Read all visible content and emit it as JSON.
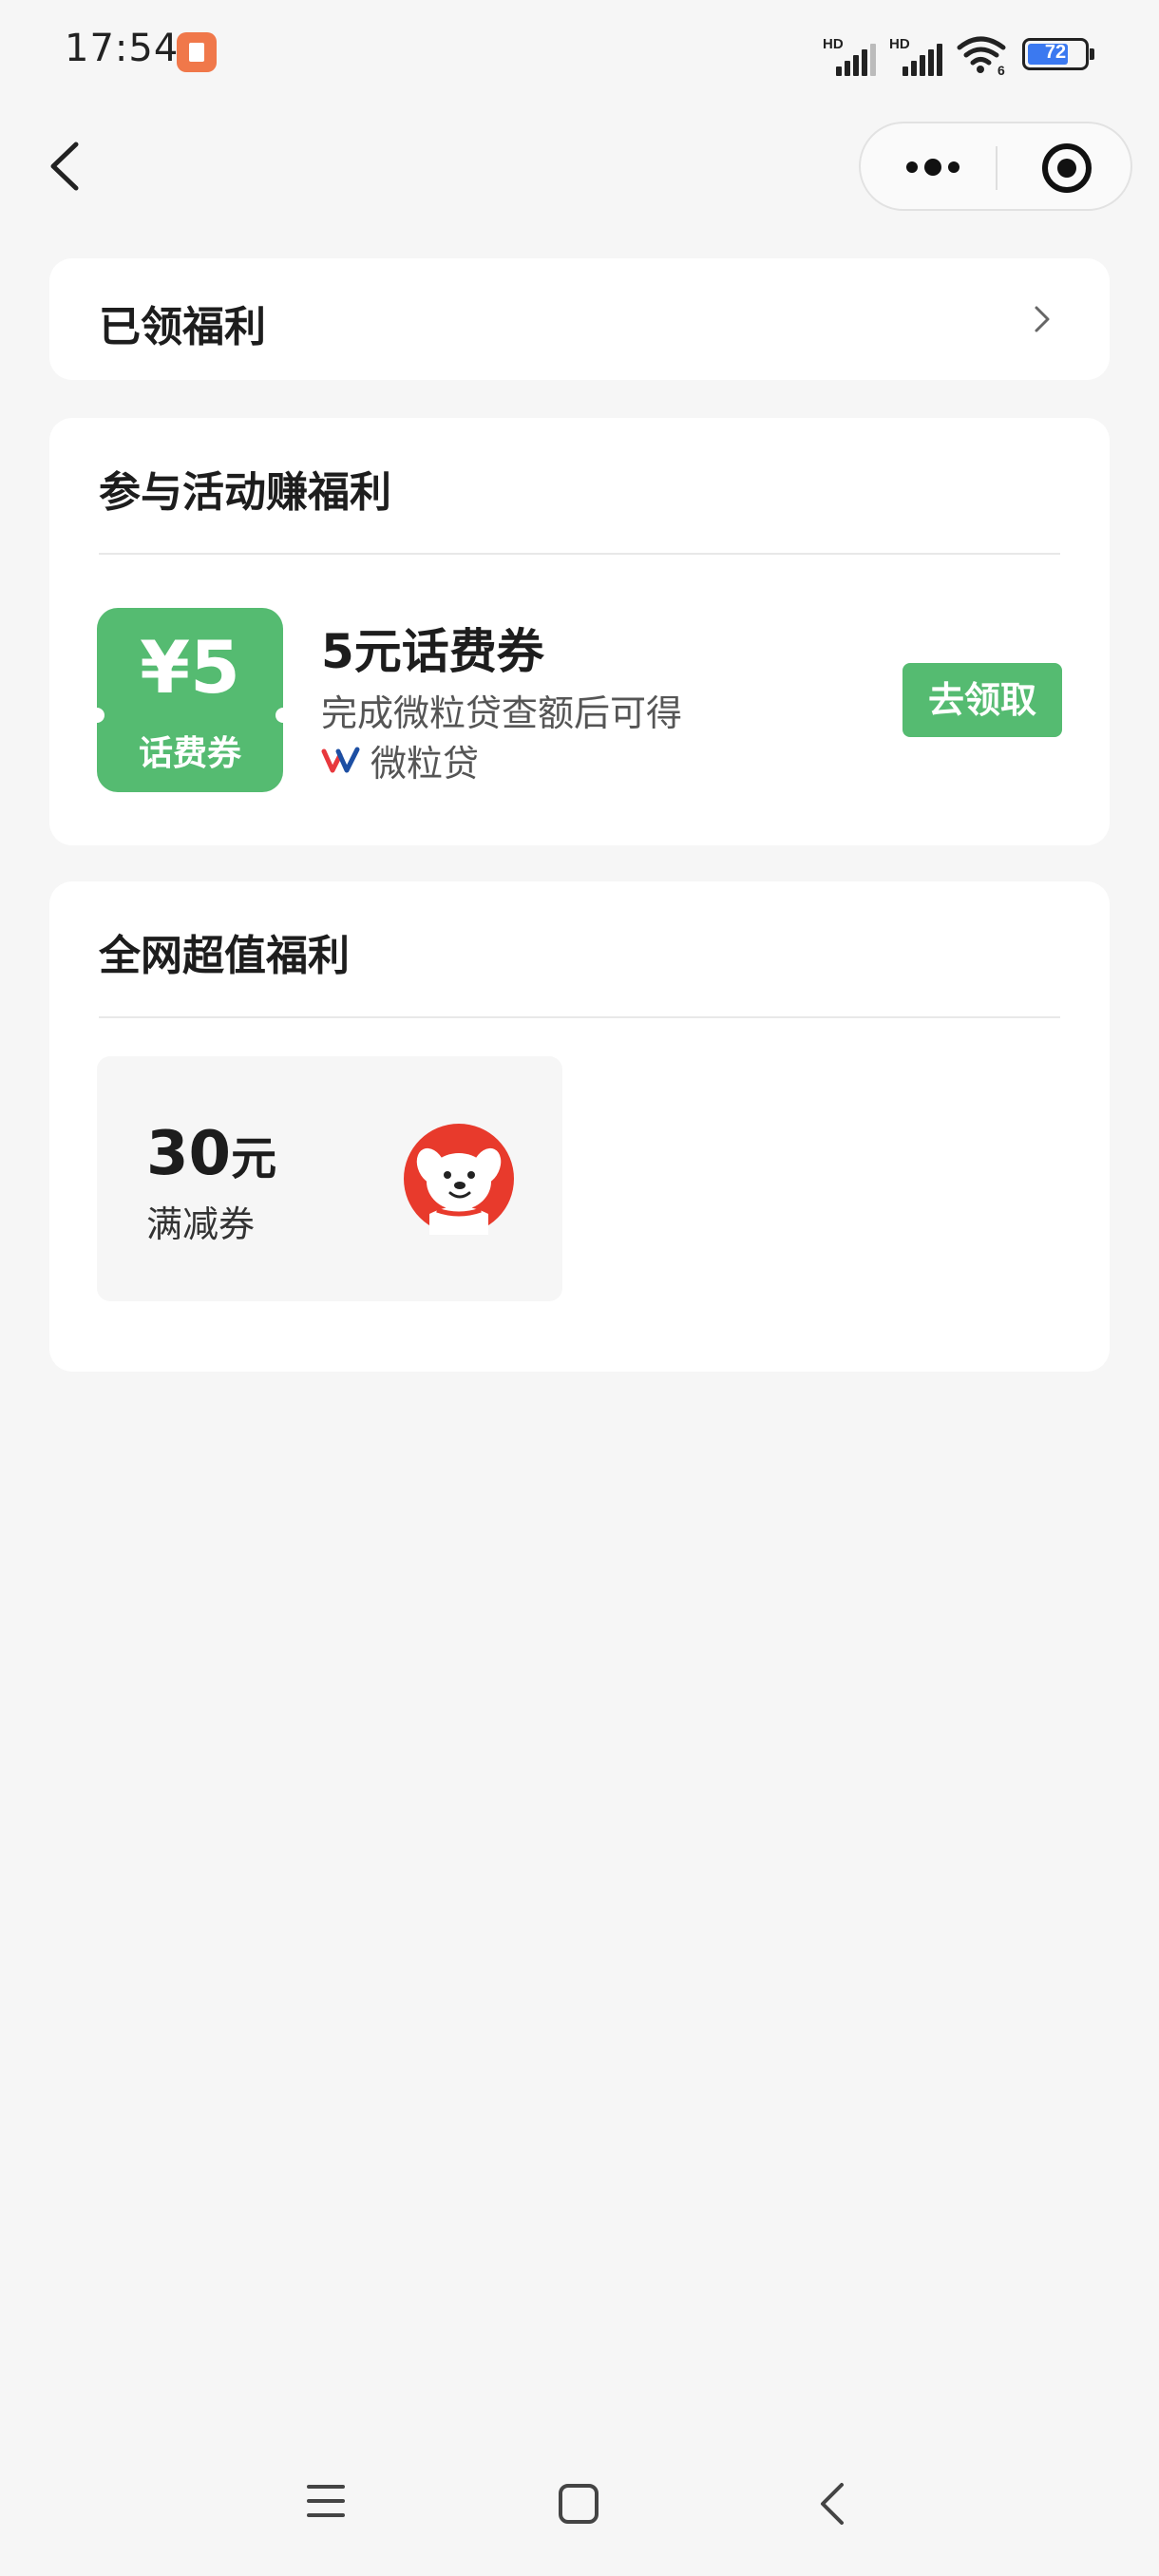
{
  "status_bar": {
    "time": "17:54",
    "signal_1_label": "HD",
    "signal_2_label": "HD",
    "wifi_badge": "6",
    "battery_percent": "72",
    "battery_level": 0.72
  },
  "nav": {
    "back_icon": "chevron-left-icon",
    "more_icon": "more-dots-icon",
    "close_icon": "target-close-icon"
  },
  "claimed": {
    "title": "已领福利",
    "arrow_icon": "chevron-right-icon"
  },
  "activity": {
    "section_title": "参与活动赚福利",
    "coupon": {
      "amount": "¥5",
      "kind": "话费券",
      "title": "5元话费券",
      "description": "完成微粒贷查额后可得",
      "provider": "微粒贷",
      "button_label": "去领取",
      "accent_color": "#55bb71"
    }
  },
  "network": {
    "section_title": "全网超值福利",
    "deal": {
      "amount": "30",
      "unit": "元",
      "label": "满减券",
      "brand_icon": "jd-mascot-icon",
      "brand_color": "#e83a2c"
    }
  },
  "system_nav": {
    "menu_icon": "menu-icon",
    "home_icon": "home-square-icon",
    "back_icon": "back-chevron-icon"
  }
}
